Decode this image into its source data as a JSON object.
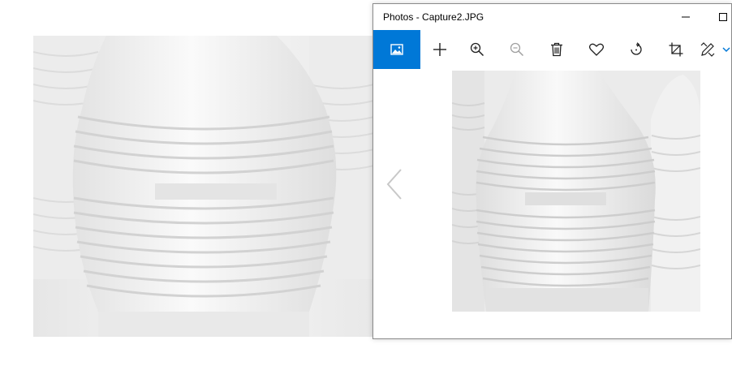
{
  "window": {
    "title": "Photos - Capture2.JPG"
  },
  "titlebar_buttons": [
    {
      "name": "minimize",
      "icon": "minimize-icon"
    },
    {
      "name": "maximize",
      "icon": "maximize-icon"
    }
  ],
  "toolbar": {
    "items": [
      {
        "name": "view-image",
        "icon": "image-icon",
        "active": true
      },
      {
        "name": "add",
        "icon": "plus-icon"
      },
      {
        "name": "zoom-in",
        "icon": "zoom-in-icon"
      },
      {
        "name": "zoom-out",
        "icon": "zoom-out-icon",
        "disabled": true
      },
      {
        "name": "delete",
        "icon": "trash-icon"
      },
      {
        "name": "favorite",
        "icon": "heart-icon"
      },
      {
        "name": "rotate",
        "icon": "rotate-icon"
      },
      {
        "name": "crop",
        "icon": "crop-icon"
      },
      {
        "name": "edit",
        "icon": "edit-draw-icon"
      }
    ]
  },
  "colors": {
    "accent": "#0078d7",
    "window_border": "#8a8a8a",
    "icon": "#1f1f1f",
    "icon_disabled": "#a0a0a0"
  }
}
